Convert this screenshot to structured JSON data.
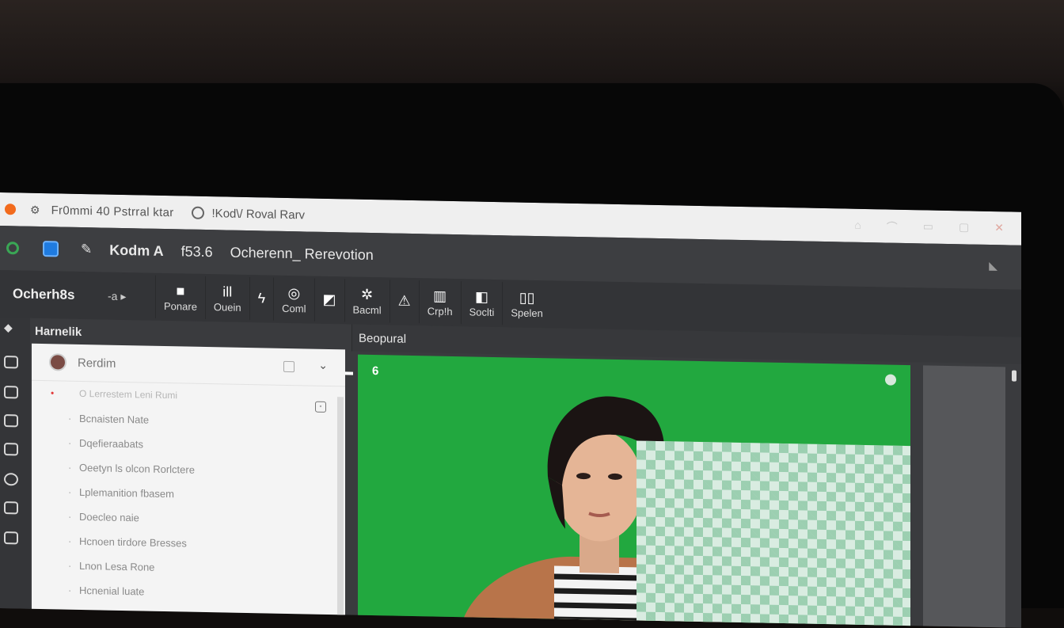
{
  "titlebar": {
    "title": "Fr0mmi 40 Pstrral ktar",
    "tab": "!Kod\\/ Roval Rarv"
  },
  "menubar": {
    "app": "Kodm A",
    "version": "f53.6",
    "doc": "Ocherenn_ Rerevotion"
  },
  "toolbar": {
    "main": "Ocherh8s",
    "arrow": "-a ▸",
    "tools": [
      {
        "icon": "■",
        "label": "Ponare"
      },
      {
        "icon": "ill",
        "label": "Ouein"
      },
      {
        "icon": "ϟ",
        "label": ""
      },
      {
        "icon": "◎",
        "label": "Coml"
      },
      {
        "icon": "◩",
        "label": ""
      },
      {
        "icon": "✲",
        "label": "Bacml"
      },
      {
        "icon": "⚠",
        "label": ""
      },
      {
        "icon": "▥",
        "label": "Crp!h"
      },
      {
        "icon": "◧",
        "label": "Soclti"
      },
      {
        "icon": "▯▯",
        "label": "Spelen"
      }
    ]
  },
  "panel": {
    "head": "Harnelik",
    "title": "Rerdim",
    "items": [
      "O Lerrestem Leni Rumi",
      "Bcnaisten Nate",
      "Dqefieraabats",
      "Oeetyn ls olcon Rorlctere",
      "Lplemanition fbasem",
      "Doecleo naie",
      "Hcnoen tirdore Bresses",
      "Lnon Lesa Rone",
      "Hcnenial luate"
    ]
  },
  "canvas": {
    "head": "Beopural",
    "corner_num": "6"
  }
}
